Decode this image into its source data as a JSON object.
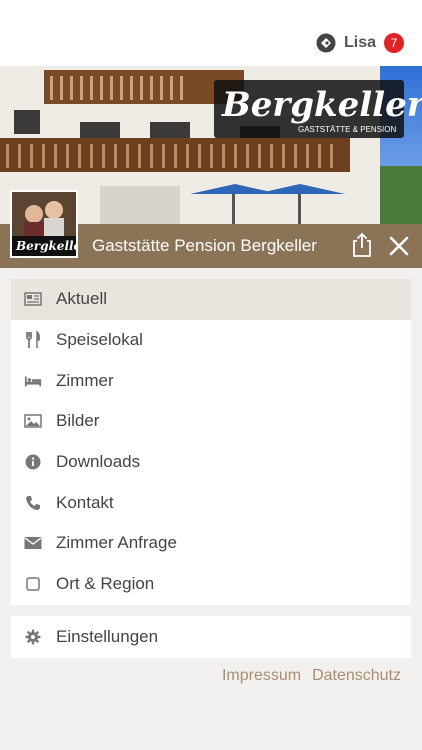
{
  "header": {
    "user_name": "Lisa",
    "badge_count": "7"
  },
  "hero": {
    "brand_title": "Bergkeller",
    "brand_subtitle": "GASTSTÄTTE & PENSION",
    "thumb_logo_text": "Bergkeller"
  },
  "titlebar": {
    "title": "Gaststätte Pension Bergkeller"
  },
  "menu": {
    "items": [
      {
        "label": "Aktuell",
        "icon": "newspaper-icon"
      },
      {
        "label": "Speiselokal",
        "icon": "fork-knife-icon"
      },
      {
        "label": "Zimmer",
        "icon": "bed-icon"
      },
      {
        "label": "Bilder",
        "icon": "image-icon"
      },
      {
        "label": "Downloads",
        "icon": "info-icon"
      },
      {
        "label": "Kontakt",
        "icon": "phone-icon"
      },
      {
        "label": "Zimmer Anfrage",
        "icon": "envelope-icon"
      },
      {
        "label": "Ort & Region",
        "icon": "square-icon"
      }
    ]
  },
  "settings": {
    "label": "Einstellungen",
    "icon": "gear-icon"
  },
  "footer": {
    "impressum": "Impressum",
    "datenschutz": "Datenschutz"
  },
  "colors": {
    "titlebar_bg": "#8a7356",
    "active_bg": "#e9e4de",
    "badge_red": "#e02424",
    "footer_link": "#a88e6e"
  }
}
